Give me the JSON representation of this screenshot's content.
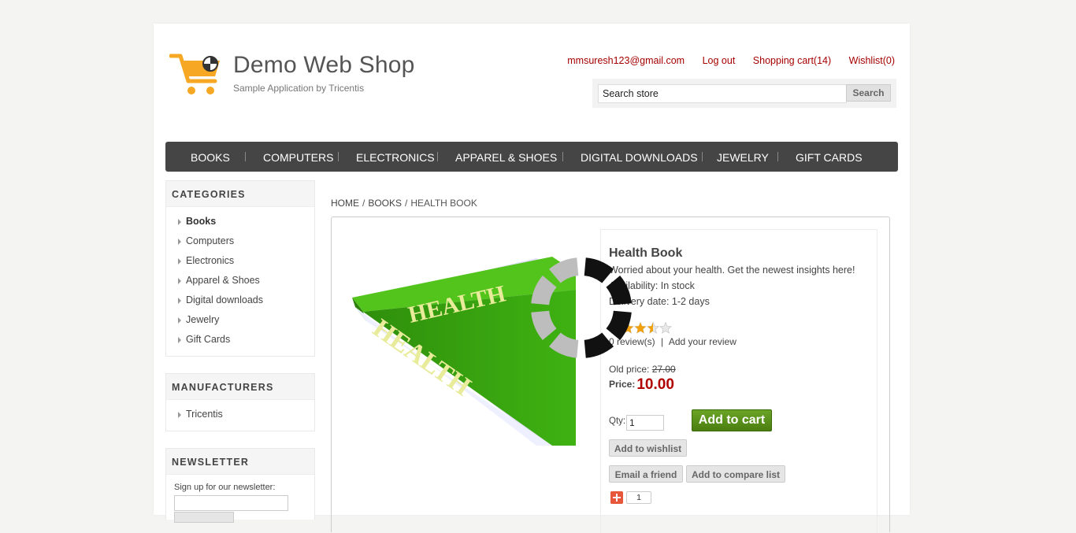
{
  "header": {
    "title": "Demo Web Shop",
    "subtitle": "Sample Application by Tricentis",
    "links": {
      "account": "mmsuresh123@gmail.com",
      "logout": "Log out",
      "cart": "Shopping cart(14)",
      "wishlist": "Wishlist(0)"
    },
    "search": {
      "value": "Search store",
      "button": "Search"
    }
  },
  "menu": [
    "BOOKS",
    "COMPUTERS",
    "ELECTRONICS",
    "APPAREL & SHOES",
    "DIGITAL DOWNLOADS",
    "JEWELRY",
    "GIFT CARDS"
  ],
  "sidebar": {
    "categories": {
      "title": "CATEGORIES",
      "items": [
        "Books",
        "Computers",
        "Electronics",
        "Apparel & Shoes",
        "Digital downloads",
        "Jewelry",
        "Gift Cards"
      ]
    },
    "manufacturers": {
      "title": "MANUFACTURERS",
      "items": [
        "Tricentis"
      ]
    },
    "newsletter": {
      "title": "NEWSLETTER",
      "label": "Sign up for our newsletter:"
    }
  },
  "breadcrumb": [
    "HOME",
    "BOOKS",
    "HEALTH BOOK"
  ],
  "product": {
    "image_text": "HEALTH",
    "name": "Health Book",
    "short_description": "Worried about your health. Get the newest insights here!",
    "availability": "Availability: In stock",
    "delivery": "Delivery date: 1-2 days",
    "rating": 3.5,
    "rating_max": 5,
    "reviews": "0 review(s)",
    "review_sep": "|",
    "add_review": "Add your review",
    "old_price_label": "Old price:",
    "old_price": "27.00",
    "price_label": "Price:",
    "price": "10.00",
    "qty_label": "Qty:",
    "qty": "1",
    "add_to_cart": "Add to cart",
    "add_to_wishlist": "Add to wishlist",
    "email_friend": "Email a friend",
    "add_to_compare": "Add to compare list",
    "share_count": "1"
  },
  "colors": {
    "link_red": "#a50000",
    "price_red": "#b00000",
    "menu_bg": "#454545",
    "cart_green": "#5a9218",
    "book_green": "#3fb212",
    "logo_orange": "#f6a723"
  },
  "icons": [
    "shopping-cart-logo-icon",
    "arrow-right-icon",
    "star-icon",
    "plus-share-icon",
    "loading-spinner-icon"
  ]
}
